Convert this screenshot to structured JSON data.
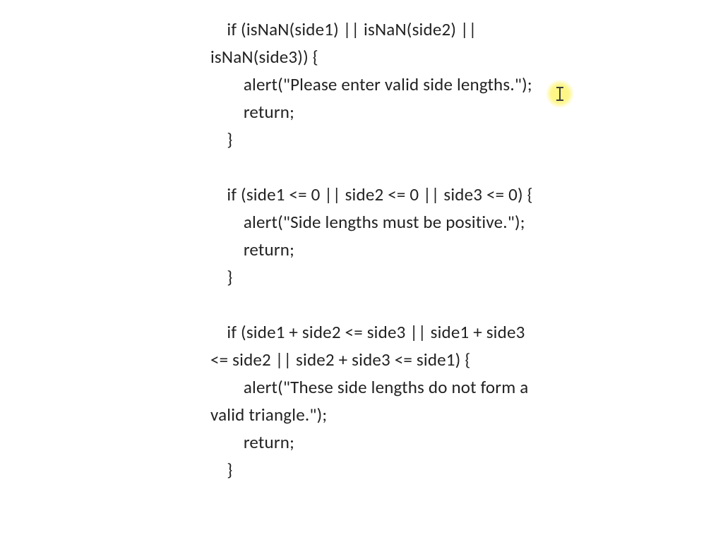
{
  "code": {
    "lines": [
      "    if (isNaN(side1) || isNaN(side2) || isNaN(side3)) {",
      "        alert(\"Please enter valid side lengths.\");",
      "        return;",
      "    }",
      "",
      "    if (side1 <= 0 || side2 <= 0 || side3 <= 0) {",
      "        alert(\"Side lengths must be positive.\");",
      "        return;",
      "    }",
      "",
      "    if (side1 + side2 <= side3 || side1 + side3 <= side2 || side2 + side3 <= side1) {",
      "        alert(\"These side lengths do not form a valid triangle.\");",
      "        return;",
      "    }"
    ]
  },
  "cursor": {
    "type": "text-ibeam",
    "highlight_color": "#fff578"
  }
}
